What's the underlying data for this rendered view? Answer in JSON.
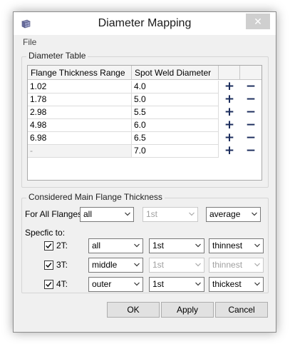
{
  "window": {
    "title": "Diameter Mapping",
    "close_glyph": "✕",
    "icon": "grid-cube-icon"
  },
  "menu": {
    "file": "File"
  },
  "diameter_table": {
    "group_title": "Diameter Table",
    "columns": [
      "Flange Thickness Range",
      "Spot Weld Diameter"
    ],
    "rows": [
      {
        "range": "1.02",
        "diameter": "4.0"
      },
      {
        "range": "1.78",
        "diameter": "5.0"
      },
      {
        "range": "2.98",
        "diameter": "5.5"
      },
      {
        "range": "4.98",
        "diameter": "6.0"
      },
      {
        "range": "6.98",
        "diameter": "6.5"
      },
      {
        "range": "-",
        "diameter": "7.0"
      }
    ],
    "add_glyph": "+",
    "remove_glyph": "−"
  },
  "considered": {
    "group_title": "Considered Main Flange Thickness",
    "all_flanges_label": "For All Flanges:",
    "all_flanges": {
      "mode": "all",
      "index": "1st",
      "method": "average"
    },
    "specific_label": "Specfic to:",
    "specific": [
      {
        "label": "2T:",
        "checked": true,
        "mode": "all",
        "index": "1st",
        "method": "thinnest",
        "method_disabled": false
      },
      {
        "label": "3T:",
        "checked": true,
        "mode": "middle",
        "index": "1st",
        "method": "thinnest",
        "method_disabled": true
      },
      {
        "label": "4T:",
        "checked": true,
        "mode": "outer",
        "index": "1st",
        "method": "thickest",
        "method_disabled": false
      }
    ]
  },
  "buttons": {
    "ok": "OK",
    "apply": "Apply",
    "cancel": "Cancel"
  }
}
